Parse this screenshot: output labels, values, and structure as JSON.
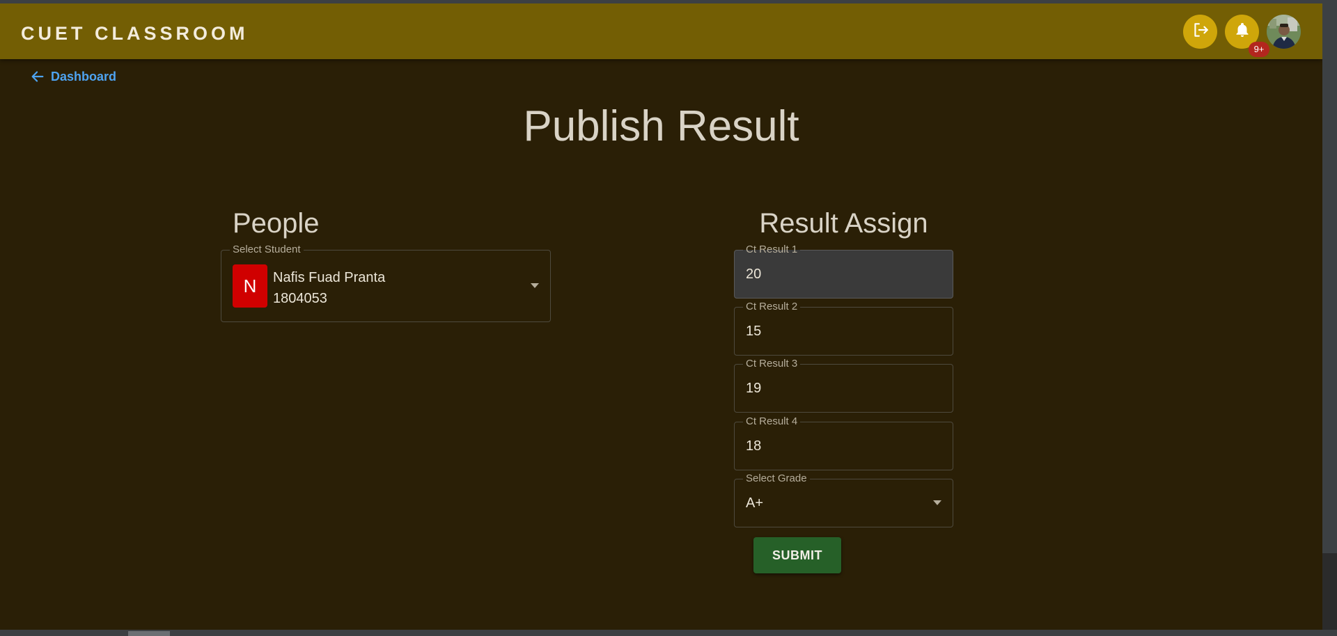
{
  "app": {
    "brand": "CUET CLASSROOM",
    "notifications_badge": "9+",
    "accent_color": "#735e04",
    "icon_button_color": "#cfa60a"
  },
  "nav": {
    "back_label": "Dashboard",
    "back_icon": "arrow-left-icon"
  },
  "page": {
    "title": "Publish Result"
  },
  "people": {
    "title": "People",
    "select_label": "Select Student",
    "student": {
      "initial": "N",
      "name": "Nafis Fuad Pranta",
      "id": "1804053"
    }
  },
  "result": {
    "title": "Result Assign",
    "fields": [
      {
        "label": "Ct Result 1",
        "value": "20"
      },
      {
        "label": "Ct Result 2",
        "value": "15"
      },
      {
        "label": "Ct Result 3",
        "value": "19"
      },
      {
        "label": "Ct Result 4",
        "value": "18"
      }
    ],
    "grade_label": "Select Grade",
    "grade_value": "A+",
    "submit_label": "SUBMIT"
  },
  "icons": {
    "logout": "logout-icon",
    "notifications": "bell-icon",
    "dropdown": "chevron-down-icon"
  }
}
